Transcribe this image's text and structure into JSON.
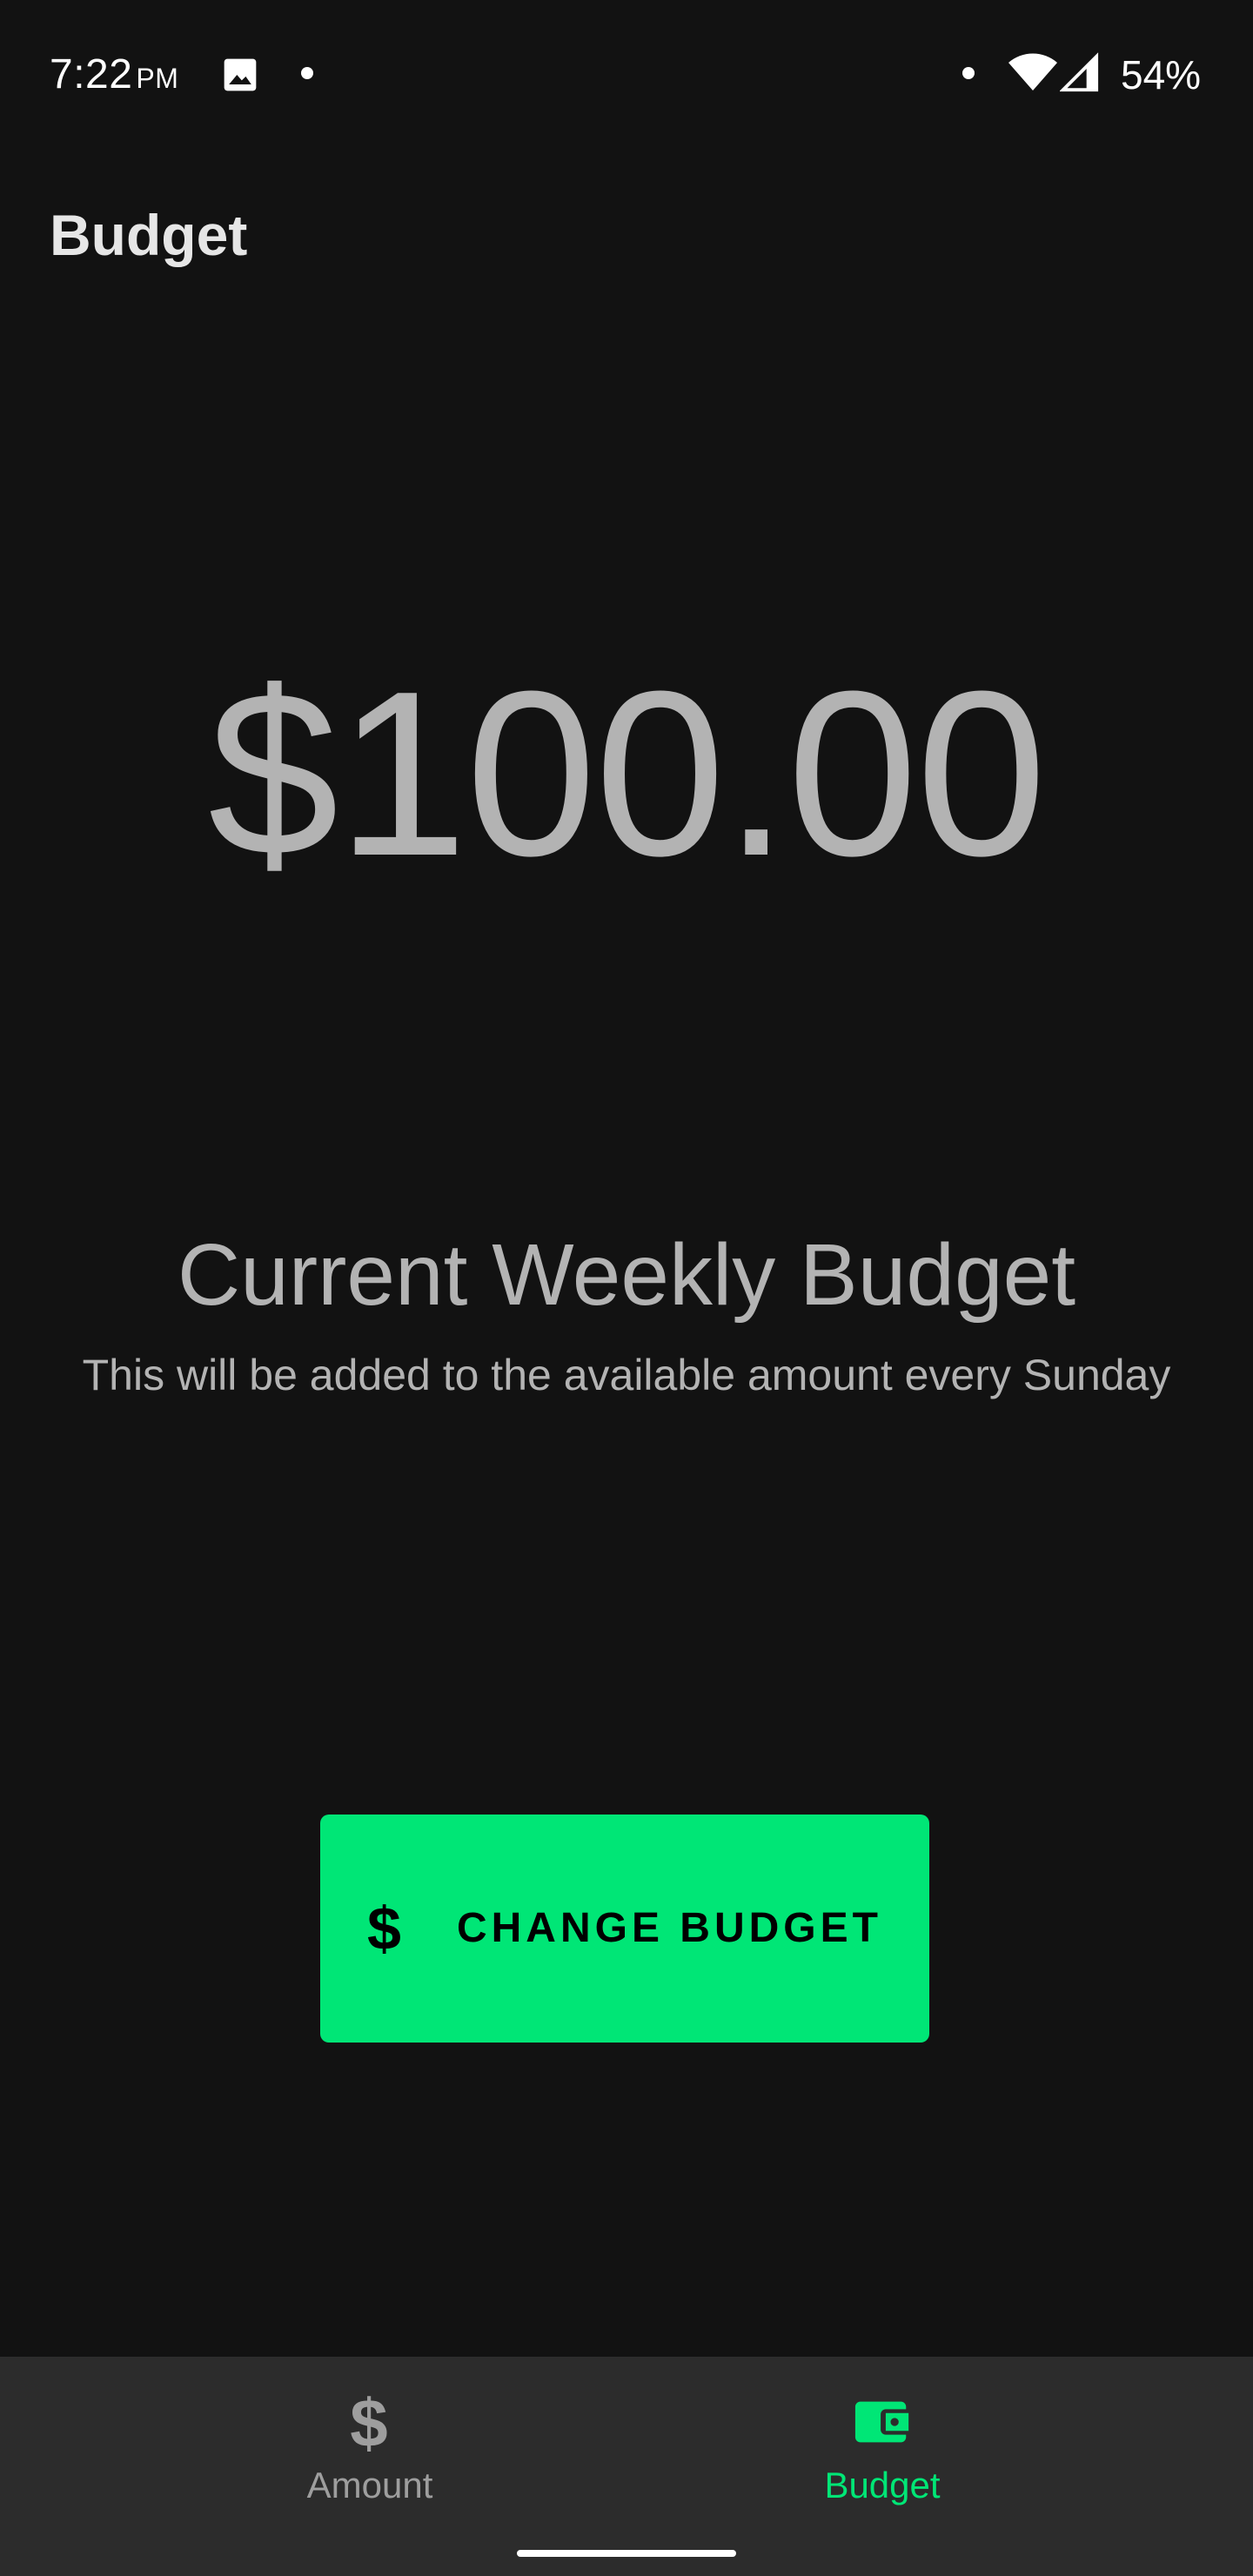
{
  "status_bar": {
    "time": "7:22",
    "ampm": "PM",
    "battery": "54%"
  },
  "app_bar": {
    "title": "Budget"
  },
  "main": {
    "amount": "$100.00",
    "title": "Current Weekly Budget",
    "subtitle": "This will be added to the available amount every Sunday",
    "change_button": {
      "icon": "dollar-icon",
      "label": "CHANGE BUDGET"
    }
  },
  "bottom_nav": {
    "items": [
      {
        "label": "Amount",
        "icon": "dollar-icon",
        "active": false
      },
      {
        "label": "Budget",
        "icon": "wallet-icon",
        "active": true
      }
    ]
  },
  "colors": {
    "background": "#121212",
    "accent": "#00e676",
    "nav_background": "#2c2c2c",
    "text_secondary": "#b3b3b3"
  }
}
